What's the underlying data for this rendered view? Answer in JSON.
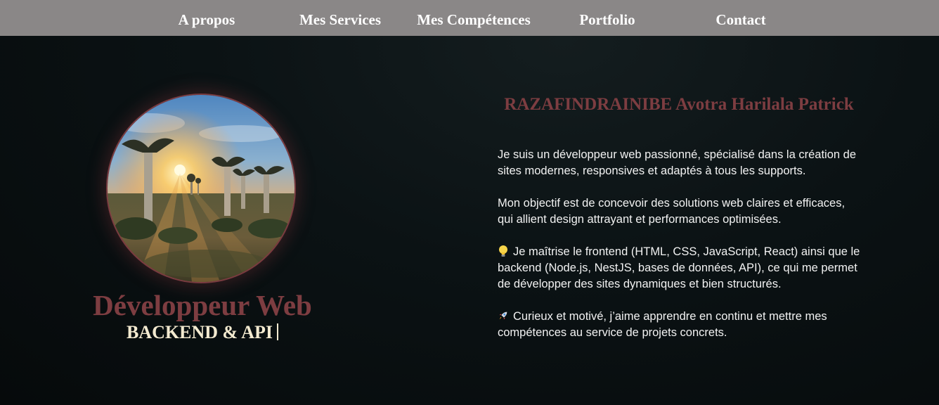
{
  "nav": {
    "items": [
      {
        "label": "A propos"
      },
      {
        "label": "Mes Services"
      },
      {
        "label": "Mes Compétences"
      },
      {
        "label": "Portfolio"
      },
      {
        "label": "Contact"
      }
    ]
  },
  "hero": {
    "avatar_icon": "baobab-sunset-photo",
    "title": "Développeur Web",
    "subtitle": "BACKEND & API"
  },
  "about": {
    "name": "RAZAFINDRAINIBE Avotra Harilala Patrick",
    "paragraphs": [
      {
        "text": "Je suis un développeur web passionné, spécialisé dans la création de sites modernes, responsives et adaptés à tous les supports."
      },
      {
        "text": "Mon objectif est de concevoir des solutions web claires et efficaces, qui allient design attrayant et performances optimisées."
      },
      {
        "icon": "lightbulb-icon",
        "text": "Je maîtrise le frontend (HTML, CSS, JavaScript, React) ainsi que le backend (Node.js, NestJS, bases de données, API), ce qui me permet de développer des sites dynamiques et bien structurés."
      },
      {
        "icon": "rocket-icon",
        "text": "Curieux et motivé, j’aime apprendre en continu et mettre mes compétences au service de projets concrets."
      }
    ]
  },
  "colors": {
    "navbar_bg": "#8a8787",
    "accent": "#7d3d41",
    "subtitle": "#f3ead0",
    "page_bg": "#0b1214"
  }
}
